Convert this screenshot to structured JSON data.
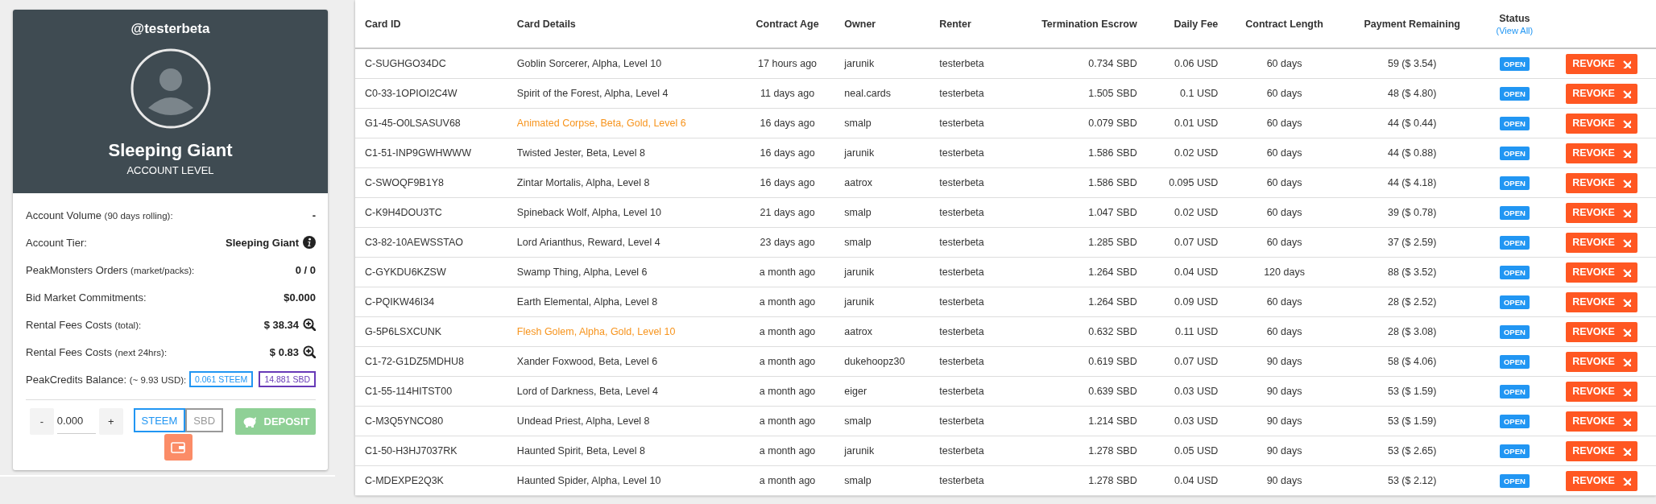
{
  "profile": {
    "username": "@testerbeta",
    "level_name": "Sleeping Giant",
    "level_caption": "ACCOUNT LEVEL"
  },
  "stats": [
    {
      "kind": "plain",
      "label": "Account Volume",
      "note": "(90 days rolling):",
      "value": "-"
    },
    {
      "kind": "info",
      "label": "Account Tier:",
      "value": "Sleeping Giant"
    },
    {
      "kind": "plain",
      "label": "PeakMonsters Orders",
      "note": "(market/packs):",
      "value": "0 / 0"
    },
    {
      "kind": "plain",
      "label": "Bid Market Commitments:",
      "value": "$0.000"
    },
    {
      "kind": "zoom",
      "label": "Rental Fees Costs",
      "note": "(total):",
      "value": "$ 38.34"
    },
    {
      "kind": "zoom",
      "label": "Rental Fees Costs",
      "note": "(next 24hrs):",
      "value": "$ 0.83"
    },
    {
      "kind": "balances",
      "label": "PeakCredits Balance:",
      "note": "(~ 9.93 USD):",
      "balances": [
        {
          "text": "0.061 STEEM",
          "color": "#2196f3"
        },
        {
          "text": "14.881 SBD",
          "color": "#673ab7"
        }
      ]
    }
  ],
  "deposit": {
    "minus": "-",
    "amount": "0.000",
    "plus": "+",
    "currencies": [
      {
        "label": "STEEM",
        "selected": true
      },
      {
        "label": "SBD",
        "selected": false
      }
    ],
    "button": "DEPOSIT"
  },
  "table": {
    "columns": [
      {
        "label": "Card ID"
      },
      {
        "label": "Card Details"
      },
      {
        "label": "Contract Age"
      },
      {
        "label": "Owner"
      },
      {
        "label": "Renter"
      },
      {
        "label": "Termination Escrow"
      },
      {
        "label": "Daily Fee"
      },
      {
        "label": "Contract Length"
      },
      {
        "label": "Payment Remaining"
      },
      {
        "label": "Status",
        "link": "(View All)"
      }
    ],
    "rows": [
      {
        "card_id": "C-SUGHGO34DC",
        "details": "Goblin Sorcerer, Alpha, Level 10",
        "gold": false,
        "age": "17 hours ago",
        "owner": "jarunik",
        "renter": "testerbeta",
        "escrow": "0.734 SBD",
        "daily_fee": "0.06 USD",
        "length": "60 days",
        "payment": "59 ($ 3.54)",
        "status": "OPEN",
        "action": "REVOKE"
      },
      {
        "card_id": "C0-33-1OPIOI2C4W",
        "details": "Spirit of the Forest, Alpha, Level 4",
        "gold": false,
        "age": "11 days ago",
        "owner": "neal.cards",
        "renter": "testerbeta",
        "escrow": "1.505 SBD",
        "daily_fee": "0.1 USD",
        "length": "60 days",
        "payment": "48 ($ 4.80)",
        "status": "OPEN",
        "action": "REVOKE"
      },
      {
        "card_id": "G1-45-O0LSASUV68",
        "details": "Animated Corpse, Beta, Gold, Level 6",
        "gold": true,
        "age": "16 days ago",
        "owner": "smalp",
        "renter": "testerbeta",
        "escrow": "0.079 SBD",
        "daily_fee": "0.01 USD",
        "length": "60 days",
        "payment": "44 ($ 0.44)",
        "status": "OPEN",
        "action": "REVOKE"
      },
      {
        "card_id": "C1-51-INP9GWHWWW",
        "details": "Twisted Jester, Beta, Level 8",
        "gold": false,
        "age": "16 days ago",
        "owner": "jarunik",
        "renter": "testerbeta",
        "escrow": "1.586 SBD",
        "daily_fee": "0.02 USD",
        "length": "60 days",
        "payment": "44 ($ 0.88)",
        "status": "OPEN",
        "action": "REVOKE"
      },
      {
        "card_id": "C-SWOQF9B1Y8",
        "details": "Zintar Mortalis, Alpha, Level 8",
        "gold": false,
        "age": "16 days ago",
        "owner": "aatrox",
        "renter": "testerbeta",
        "escrow": "1.586 SBD",
        "daily_fee": "0.095 USD",
        "length": "60 days",
        "payment": "44 ($ 4.18)",
        "status": "OPEN",
        "action": "REVOKE"
      },
      {
        "card_id": "C-K9H4DOU3TC",
        "details": "Spineback Wolf, Alpha, Level 10",
        "gold": false,
        "age": "21 days ago",
        "owner": "smalp",
        "renter": "testerbeta",
        "escrow": "1.047 SBD",
        "daily_fee": "0.02 USD",
        "length": "60 days",
        "payment": "39 ($ 0.78)",
        "status": "OPEN",
        "action": "REVOKE"
      },
      {
        "card_id": "C3-82-10AEWSSTAO",
        "details": "Lord Arianthus, Reward, Level 4",
        "gold": false,
        "age": "23 days ago",
        "owner": "smalp",
        "renter": "testerbeta",
        "escrow": "1.285 SBD",
        "daily_fee": "0.07 USD",
        "length": "60 days",
        "payment": "37 ($ 2.59)",
        "status": "OPEN",
        "action": "REVOKE"
      },
      {
        "card_id": "C-GYKDU6KZSW",
        "details": "Swamp Thing, Alpha, Level 6",
        "gold": false,
        "age": "a month ago",
        "owner": "jarunik",
        "renter": "testerbeta",
        "escrow": "1.264 SBD",
        "daily_fee": "0.04 USD",
        "length": "120 days",
        "payment": "88 ($ 3.52)",
        "status": "OPEN",
        "action": "REVOKE"
      },
      {
        "card_id": "C-PQIKW46I34",
        "details": "Earth Elemental, Alpha, Level 8",
        "gold": false,
        "age": "a month ago",
        "owner": "jarunik",
        "renter": "testerbeta",
        "escrow": "1.264 SBD",
        "daily_fee": "0.09 USD",
        "length": "60 days",
        "payment": "28 ($ 2.52)",
        "status": "OPEN",
        "action": "REVOKE"
      },
      {
        "card_id": "G-5P6LSXCUNK",
        "details": "Flesh Golem, Alpha, Gold, Level 10",
        "gold": true,
        "age": "a month ago",
        "owner": "aatrox",
        "renter": "testerbeta",
        "escrow": "0.632 SBD",
        "daily_fee": "0.11 USD",
        "length": "60 days",
        "payment": "28 ($ 3.08)",
        "status": "OPEN",
        "action": "REVOKE"
      },
      {
        "card_id": "C1-72-G1DZ5MDHU8",
        "details": "Xander Foxwood, Beta, Level 6",
        "gold": false,
        "age": "a month ago",
        "owner": "dukehoopz30",
        "renter": "testerbeta",
        "escrow": "0.619 SBD",
        "daily_fee": "0.07 USD",
        "length": "90 days",
        "payment": "58 ($ 4.06)",
        "status": "OPEN",
        "action": "REVOKE"
      },
      {
        "card_id": "C1-55-114HITST00",
        "details": "Lord of Darkness, Beta, Level 4",
        "gold": false,
        "age": "a month ago",
        "owner": "eiger",
        "renter": "testerbeta",
        "escrow": "0.639 SBD",
        "daily_fee": "0.03 USD",
        "length": "90 days",
        "payment": "53 ($ 1.59)",
        "status": "OPEN",
        "action": "REVOKE"
      },
      {
        "card_id": "C-M3Q5YNCO80",
        "details": "Undead Priest, Alpha, Level 8",
        "gold": false,
        "age": "a month ago",
        "owner": "smalp",
        "renter": "testerbeta",
        "escrow": "1.214 SBD",
        "daily_fee": "0.03 USD",
        "length": "90 days",
        "payment": "53 ($ 1.59)",
        "status": "OPEN",
        "action": "REVOKE"
      },
      {
        "card_id": "C1-50-H3HJ7037RK",
        "details": "Haunted Spirit, Beta, Level 8",
        "gold": false,
        "age": "a month ago",
        "owner": "jarunik",
        "renter": "testerbeta",
        "escrow": "1.278 SBD",
        "daily_fee": "0.05 USD",
        "length": "90 days",
        "payment": "53 ($ 2.65)",
        "status": "OPEN",
        "action": "REVOKE"
      },
      {
        "card_id": "C-MDEXPE2Q3K",
        "details": "Haunted Spider, Alpha, Level 10",
        "gold": false,
        "age": "a month ago",
        "owner": "smalp",
        "renter": "testerbeta",
        "escrow": "1.278 SBD",
        "daily_fee": "0.04 USD",
        "length": "90 days",
        "payment": "53 ($ 2.12)",
        "status": "OPEN",
        "action": "REVOKE"
      }
    ]
  }
}
